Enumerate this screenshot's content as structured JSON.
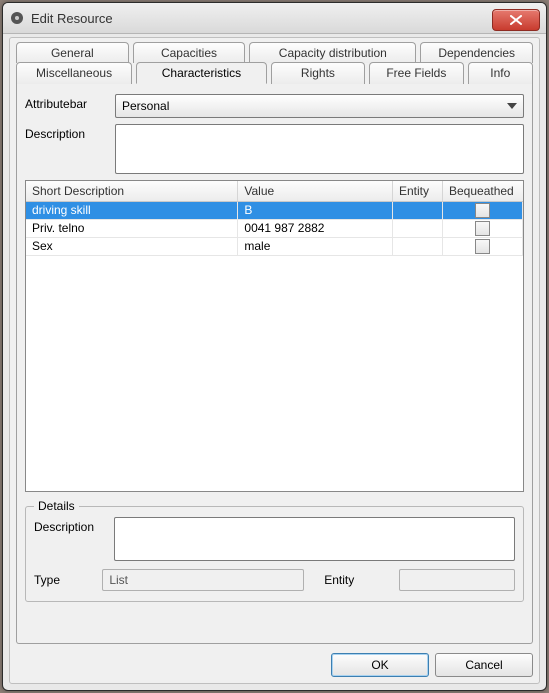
{
  "window": {
    "title": "Edit Resource"
  },
  "tabs": {
    "row1": [
      {
        "label": "General"
      },
      {
        "label": "Capacities"
      },
      {
        "label": "Capacity distribution"
      },
      {
        "label": "Dependencies"
      }
    ],
    "row2": [
      {
        "label": "Miscellaneous"
      },
      {
        "label": "Characteristics",
        "active": true
      },
      {
        "label": "Rights"
      },
      {
        "label": "Free Fields"
      },
      {
        "label": "Info"
      }
    ]
  },
  "form": {
    "attributebar_label": "Attributebar",
    "attributebar_value": "Personal",
    "description_label": "Description",
    "description_value": ""
  },
  "table": {
    "headers": {
      "desc": "Short Description",
      "value": "Value",
      "entity": "Entity",
      "beq": "Bequeathed"
    },
    "rows": [
      {
        "desc": "driving skill",
        "value": "B",
        "entity": "",
        "selected": true
      },
      {
        "desc": "Priv. telno",
        "value": "0041 987 2882",
        "entity": "",
        "selected": false
      },
      {
        "desc": "Sex",
        "value": "male",
        "entity": "",
        "selected": false
      }
    ]
  },
  "details": {
    "legend": "Details",
    "description_label": "Description",
    "description_value": "",
    "type_label": "Type",
    "type_value": "List",
    "entity_label": "Entity",
    "entity_value": ""
  },
  "buttons": {
    "ok": "OK",
    "cancel": "Cancel"
  }
}
